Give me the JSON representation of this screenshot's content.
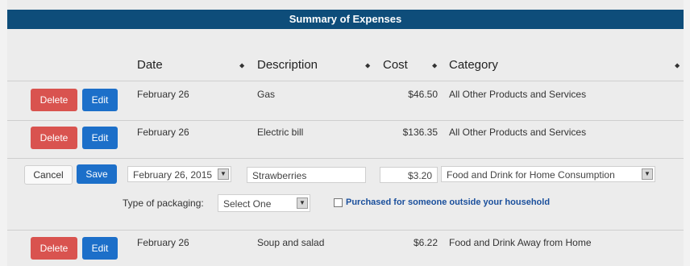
{
  "title": "Summary of Expenses",
  "columns": {
    "date": "Date",
    "description": "Description",
    "cost": "Cost",
    "category": "Category",
    "sort_glyph": "⬥"
  },
  "buttons": {
    "delete": "Delete",
    "edit": "Edit",
    "cancel": "Cancel",
    "save": "Save"
  },
  "rows": [
    {
      "date": "February 26",
      "description": "Gas",
      "cost": "$46.50",
      "category": "All Other Products and Services"
    },
    {
      "date": "February 26",
      "description": "Electric bill",
      "cost": "$136.35",
      "category": "All Other Products and Services"
    },
    {
      "date": "February 26",
      "description": "Soup and salad",
      "cost": "$6.22",
      "category": "Food and Drink Away from Home"
    }
  ],
  "edit_row": {
    "date_value": "February 26, 2015",
    "description_value": "Strawberries",
    "cost_value": "$3.20",
    "category_value": "Food and Drink for Home Consumption",
    "packaging_label": "Type of packaging:",
    "packaging_value": "Select One",
    "checkbox_label": "Purchased for someone outside your household",
    "dropdown_glyph": "▼"
  },
  "colors": {
    "header_bar": "#0e4d7a",
    "delete": "#d9534f",
    "edit": "#1c6fc9",
    "link": "#1a4f9c"
  }
}
